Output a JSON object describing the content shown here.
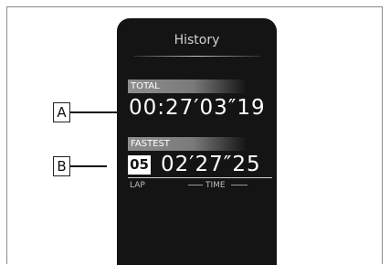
{
  "screen": {
    "title": "History",
    "total": {
      "label": "TOTAL",
      "time": "00:27′03″19"
    },
    "fastest": {
      "label": "FASTEST",
      "lap": "05",
      "time": "02′27″25",
      "lap_label": "LAP",
      "time_label": "TIME",
      "marker_icon": "star-icon"
    }
  },
  "callouts": {
    "a": "A",
    "b": "B"
  }
}
